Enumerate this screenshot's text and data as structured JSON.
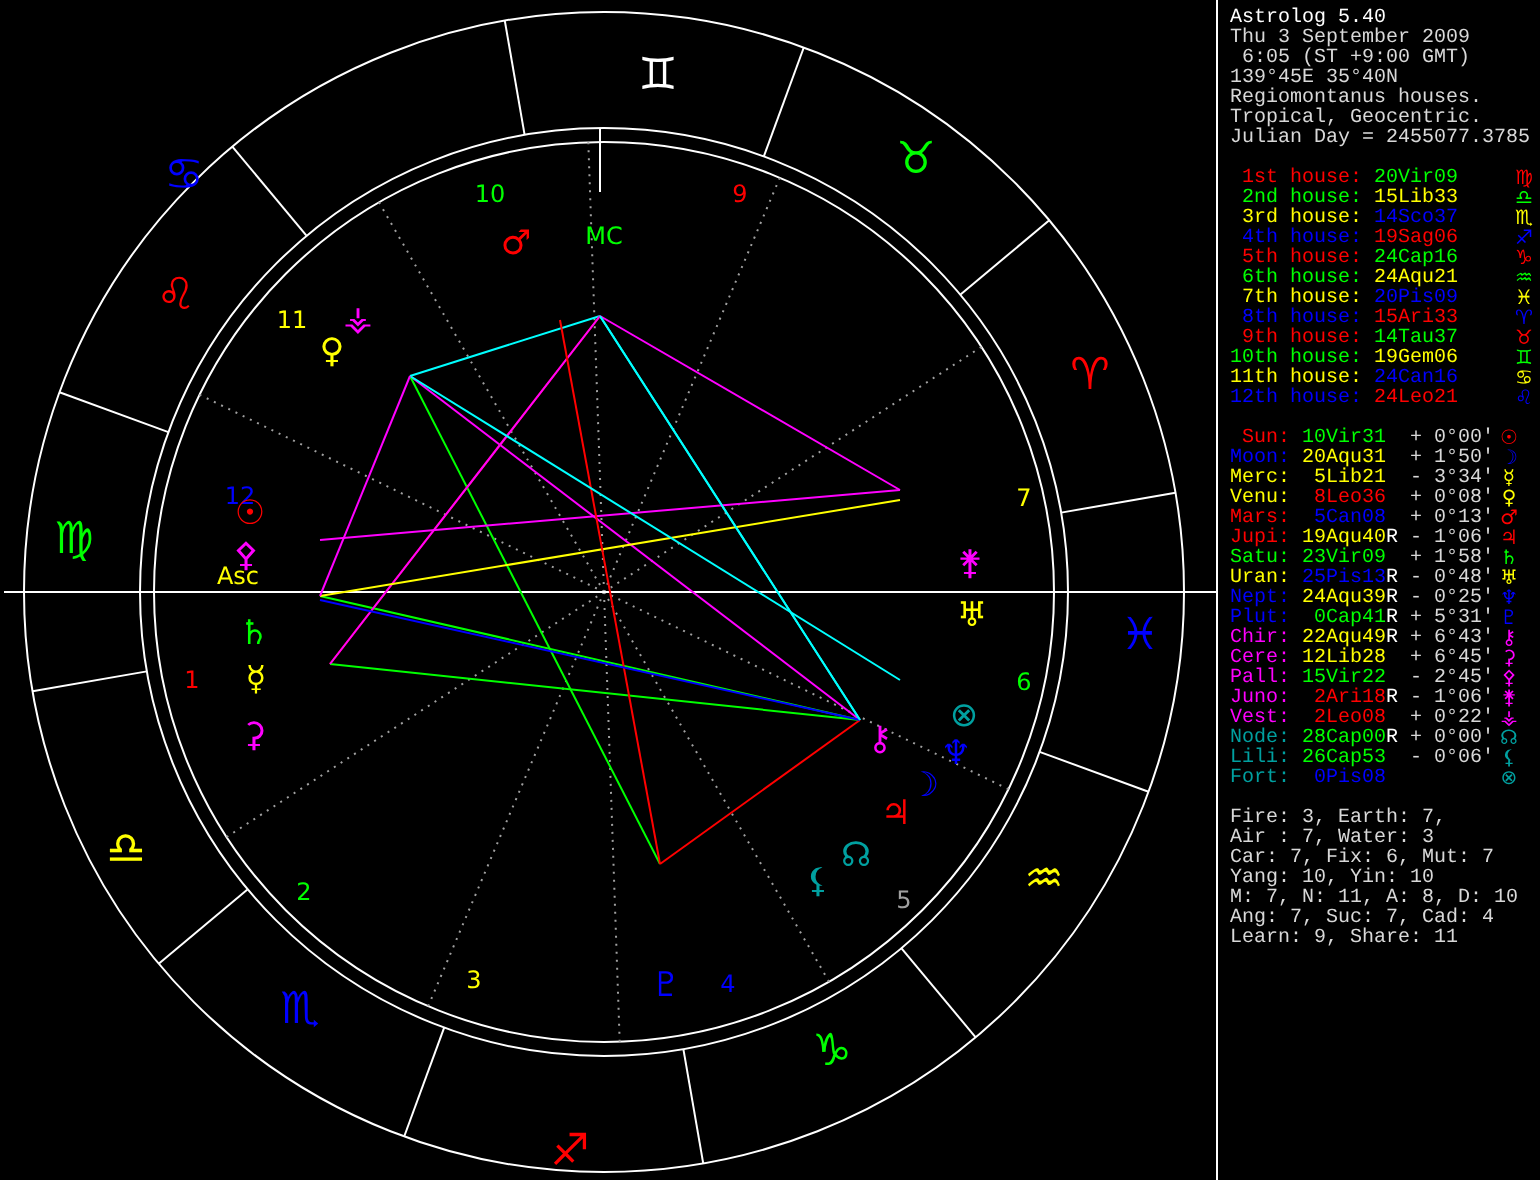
{
  "chart": {
    "signs": [
      {
        "glyph": "♊",
        "color": "#ffffff"
      },
      {
        "glyph": "♋",
        "color": "#0000ff"
      },
      {
        "glyph": "♉",
        "color": "#00ff00"
      },
      {
        "glyph": "♌",
        "color": "#ff0000"
      },
      {
        "glyph": "♈",
        "color": "#ff0000"
      },
      {
        "glyph": "♍",
        "color": "#00ff00"
      },
      {
        "glyph": "♓",
        "color": "#0000ff"
      },
      {
        "glyph": "♎",
        "color": "#ffff00"
      },
      {
        "glyph": "♒",
        "color": "#ffff00"
      },
      {
        "glyph": "♏",
        "color": "#0000ff"
      },
      {
        "glyph": "♑",
        "color": "#00ff00"
      },
      {
        "glyph": "♐",
        "color": "#ff0000"
      }
    ],
    "house_numbers": [
      {
        "label": "10",
        "color": "#00ff00"
      },
      {
        "label": "9",
        "color": "#ff0000"
      },
      {
        "label": "11",
        "color": "#ffff00"
      },
      {
        "label": "12",
        "color": "#0000ff"
      },
      {
        "label": "7",
        "color": "#ffff00"
      },
      {
        "label": "1",
        "color": "#ff0000"
      },
      {
        "label": "6",
        "color": "#00ff00"
      },
      {
        "label": "2",
        "color": "#00ff00"
      },
      {
        "label": "5",
        "color": "#a0a0a0"
      },
      {
        "label": "3",
        "color": "#ffff00"
      },
      {
        "label": "4",
        "color": "#0000ff"
      }
    ],
    "angles": [
      {
        "label": "MC",
        "color": "#00ff00"
      },
      {
        "label": "Asc",
        "color": "#ffff00"
      }
    ],
    "planets": [
      {
        "glyph": "♂",
        "color": "#ff0000"
      },
      {
        "glyph": "⚶",
        "color": "#ff00ff"
      },
      {
        "glyph": "♀",
        "color": "#ffff00"
      },
      {
        "glyph": "☉",
        "color": "#ff0000"
      },
      {
        "glyph": "⚴",
        "color": "#ff00ff"
      },
      {
        "glyph": "⚵",
        "color": "#ff00ff"
      },
      {
        "glyph": "♄",
        "color": "#00ff00"
      },
      {
        "glyph": "♅",
        "color": "#ffff00"
      },
      {
        "glyph": "☿",
        "color": "#ffff00"
      },
      {
        "glyph": "⊗",
        "color": "#00a0a0"
      },
      {
        "glyph": "⚳",
        "color": "#ff00ff"
      },
      {
        "glyph": "⚷",
        "color": "#ff00ff"
      },
      {
        "glyph": "♆",
        "color": "#0000ff"
      },
      {
        "glyph": "☽",
        "color": "#0000ff"
      },
      {
        "glyph": "♃",
        "color": "#ff0000"
      },
      {
        "glyph": "☊",
        "color": "#00a0a0"
      },
      {
        "glyph": "⚸",
        "color": "#00a0a0"
      },
      {
        "glyph": "♇",
        "color": "#0000ff"
      }
    ]
  },
  "info": {
    "title": "Astrolog 5.40",
    "lines": [
      "Thu 3 September 2009",
      " 6:05 (ST +9:00 GMT)",
      "139°45E 35°40N",
      "Regiomontanus houses.",
      "Tropical, Geocentric.",
      "Julian Day = 2455077.3785"
    ]
  },
  "houses": [
    {
      "label": "1st house:",
      "color": "#ff0000",
      "position": {
        "text": "20Vir09",
        "color": "#00ff00"
      },
      "glyph": "♍"
    },
    {
      "label": "2nd house:",
      "color": "#00ff00",
      "position": {
        "text": "15Lib33",
        "color": "#ffff00"
      },
      "glyph": "♎"
    },
    {
      "label": "3rd house:",
      "color": "#ffff00",
      "position": {
        "text": "14Sco37",
        "color": "#0000ff"
      },
      "glyph": "♏"
    },
    {
      "label": "4th house:",
      "color": "#0000ff",
      "position": {
        "text": "19Sag06",
        "color": "#ff0000"
      },
      "glyph": "♐"
    },
    {
      "label": "5th house:",
      "color": "#ff0000",
      "position": {
        "text": "24Cap16",
        "color": "#00ff00"
      },
      "glyph": "♑"
    },
    {
      "label": "6th house:",
      "color": "#00ff00",
      "position": {
        "text": "24Aqu21",
        "color": "#ffff00"
      },
      "glyph": "♒"
    },
    {
      "label": "7th house:",
      "color": "#ffff00",
      "position": {
        "text": "20Pis09",
        "color": "#0000ff"
      },
      "glyph": "♓"
    },
    {
      "label": "8th house:",
      "color": "#0000ff",
      "position": {
        "text": "15Ari33",
        "color": "#ff0000"
      },
      "glyph": "♈"
    },
    {
      "label": "9th house:",
      "color": "#ff0000",
      "position": {
        "text": "14Tau37",
        "color": "#00ff00"
      },
      "glyph": "♉"
    },
    {
      "label": "10th house:",
      "color": "#00ff00",
      "position": {
        "text": "19Gem06",
        "color": "#ffff00"
      },
      "glyph": "♊"
    },
    {
      "label": "11th house:",
      "color": "#ffff00",
      "position": {
        "text": "24Can16",
        "color": "#0000ff"
      },
      "glyph": "♋"
    },
    {
      "label": "12th house:",
      "color": "#0000ff",
      "position": {
        "text": "24Leo21",
        "color": "#ff0000"
      },
      "glyph": "♌"
    }
  ],
  "planets": [
    {
      "name": "Sun:",
      "color": "#ff0000",
      "position": {
        "text": "10Vir31",
        "color": "#00ff00"
      },
      "latitude": "+ 0°00'",
      "glyph": "☉"
    },
    {
      "name": "Moon:",
      "color": "#0000ff",
      "position": {
        "text": "20Aqu31",
        "color": "#ffff00"
      },
      "latitude": "+ 1°50'",
      "glyph": "☽"
    },
    {
      "name": "Merc:",
      "color": "#ffff00",
      "position": {
        "text": "5Lib21",
        "color": "#ffff00"
      },
      "latitude": "- 3°34'",
      "glyph": "☿"
    },
    {
      "name": "Venu:",
      "color": "#ffff00",
      "position": {
        "text": "8Leo36",
        "color": "#ff0000"
      },
      "latitude": "+ 0°08'",
      "glyph": "♀"
    },
    {
      "name": "Mars:",
      "color": "#ff0000",
      "position": {
        "text": "5Can08",
        "color": "#0000ff"
      },
      "latitude": "+ 0°13'",
      "glyph": "♂"
    },
    {
      "name": "Jupi:",
      "color": "#ff0000",
      "position": {
        "text": "19Aqu40",
        "color": "#ffff00"
      },
      "retrograde_mark": "R",
      "latitude": "- 1°06'",
      "glyph": "♃"
    },
    {
      "name": "Satu:",
      "color": "#00ff00",
      "position": {
        "text": "23Vir09",
        "color": "#00ff00"
      },
      "latitude": "+ 1°58'",
      "glyph": "♄"
    },
    {
      "name": "Uran:",
      "color": "#ffff00",
      "position": {
        "text": "25Pis13",
        "color": "#0000ff"
      },
      "retrograde_mark": "R",
      "latitude": "- 0°48'",
      "glyph": "♅"
    },
    {
      "name": "Nept:",
      "color": "#0000ff",
      "position": {
        "text": "24Aqu39",
        "color": "#ffff00"
      },
      "retrograde_mark": "R",
      "latitude": "- 0°25'",
      "glyph": "♆"
    },
    {
      "name": "Plut:",
      "color": "#0000ff",
      "position": {
        "text": "0Cap41",
        "color": "#00ff00"
      },
      "retrograde_mark": "R",
      "latitude": "+ 5°31'",
      "glyph": "♇"
    },
    {
      "name": "Chir:",
      "color": "#ff00ff",
      "position": {
        "text": "22Aqu49",
        "color": "#ffff00"
      },
      "retrograde_mark": "R",
      "latitude": "+ 6°43'",
      "glyph": "⚷"
    },
    {
      "name": "Cere:",
      "color": "#ff00ff",
      "position": {
        "text": "12Lib28",
        "color": "#ffff00"
      },
      "latitude": "+ 6°45'",
      "glyph": "⚳"
    },
    {
      "name": "Pall:",
      "color": "#ff00ff",
      "position": {
        "text": "15Vir22",
        "color": "#00ff00"
      },
      "latitude": "- 2°45'",
      "glyph": "⚴"
    },
    {
      "name": "Juno:",
      "color": "#ff00ff",
      "position": {
        "text": "2Ari18",
        "color": "#ff0000"
      },
      "retrograde_mark": "R",
      "latitude": "- 1°06'",
      "glyph": "⚵"
    },
    {
      "name": "Vest:",
      "color": "#ff00ff",
      "position": {
        "text": "2Leo08",
        "color": "#ff0000"
      },
      "latitude": "+ 0°22'",
      "glyph": "⚶"
    },
    {
      "name": "Node:",
      "color": "#00a0a0",
      "position": {
        "text": "28Cap00",
        "color": "#00ff00"
      },
      "retrograde_mark": "R",
      "latitude": "+ 0°00'",
      "glyph": "☊"
    },
    {
      "name": "Lili:",
      "color": "#00a0a0",
      "position": {
        "text": "26Cap53",
        "color": "#00ff00"
      },
      "latitude": "- 0°06'",
      "glyph": "⚸"
    },
    {
      "name": "Fort:",
      "color": "#00a0a0",
      "position": {
        "text": "0Pis08",
        "color": "#0000ff"
      },
      "glyph": "⊗"
    }
  ],
  "summary": [
    "Fire: 3, Earth: 7,",
    "Air : 7, Water: 3",
    "Car: 7, Fix: 6, Mut: 7",
    "Yang: 10, Yin: 10",
    "M: 7, N: 11, A: 8, D: 10",
    "Ang: 7, Suc: 7, Cad: 4",
    "Learn: 9, Share: 11"
  ]
}
